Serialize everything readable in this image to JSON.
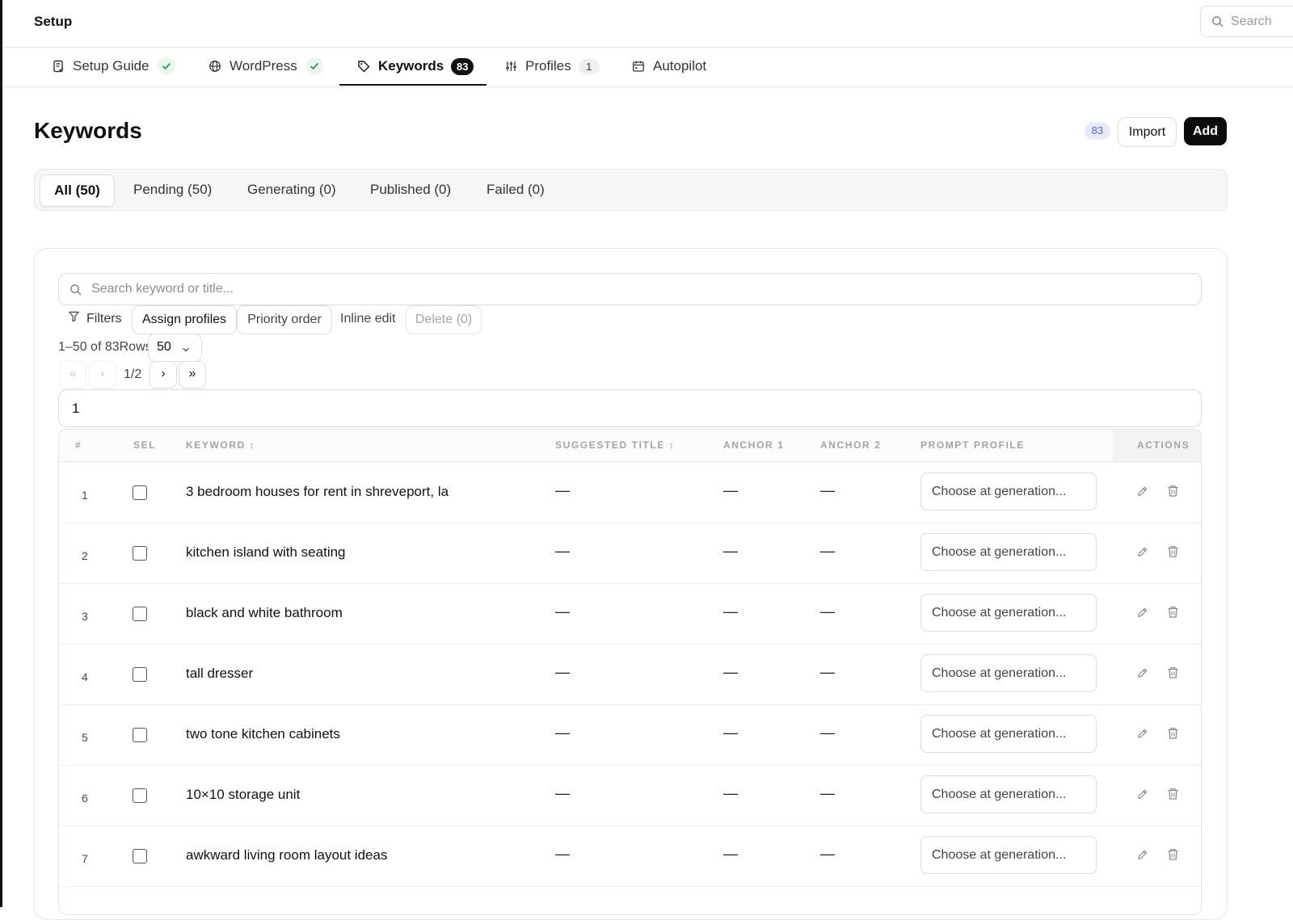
{
  "app": {
    "title": "Setup",
    "search_placeholder": "Search"
  },
  "tabs": [
    {
      "label": "Setup Guide",
      "check": true
    },
    {
      "label": "WordPress",
      "check": true
    },
    {
      "label": "Keywords",
      "count": "83"
    },
    {
      "label": "Profiles",
      "count": "1"
    },
    {
      "label": "Autopilot"
    }
  ],
  "active_tab": "Keywords",
  "page": {
    "title": "Keywords",
    "count_badge": "83",
    "import_label": "Import",
    "add_label": "Add"
  },
  "status_tabs": [
    "All (50)",
    "Pending (50)",
    "Generating (0)",
    "Published (0)",
    "Failed (0)"
  ],
  "active_status_tab": "All (50)",
  "toolbar": {
    "search_placeholder": "Search keyword or title...",
    "filters_label": "Filters",
    "assign_label": "Assign profiles",
    "priority_label": "Priority order",
    "inline_edit_label": "Inline edit",
    "delete_label": "Delete (0)"
  },
  "pagination": {
    "range_text": "1–50 of 83",
    "rows_label": "Rows",
    "rows_value": "50",
    "first": "«",
    "prev": "‹",
    "page_label": "1/2",
    "next": "›",
    "last": "»",
    "page_input_value": "1"
  },
  "table": {
    "headers": {
      "num": "#",
      "sel": "SEL",
      "keyword": "KEYWORD ↕",
      "title": "SUGGESTED TITLE ↕",
      "anchor1": "ANCHOR 1",
      "anchor2": "ANCHOR 2",
      "profile": "PROMPT PROFILE",
      "actions": "ACTIONS"
    },
    "empty_marker": "—",
    "profile_placeholder": "Choose at generation...",
    "rows": [
      {
        "num": "1",
        "keyword": "3 bedroom houses for rent in shreveport, la"
      },
      {
        "num": "2",
        "keyword": "kitchen island with seating"
      },
      {
        "num": "3",
        "keyword": "black and white bathroom"
      },
      {
        "num": "4",
        "keyword": "tall dresser"
      },
      {
        "num": "5",
        "keyword": "two tone kitchen cabinets"
      },
      {
        "num": "6",
        "keyword": "10×10 storage unit"
      },
      {
        "num": "7",
        "keyword": "awkward living room layout ideas"
      }
    ]
  },
  "colors": {
    "accent": "#111111",
    "badge_bg": "#e8ebff",
    "badge_text": "#5a63d8",
    "check_green": "#1e9c4c"
  }
}
